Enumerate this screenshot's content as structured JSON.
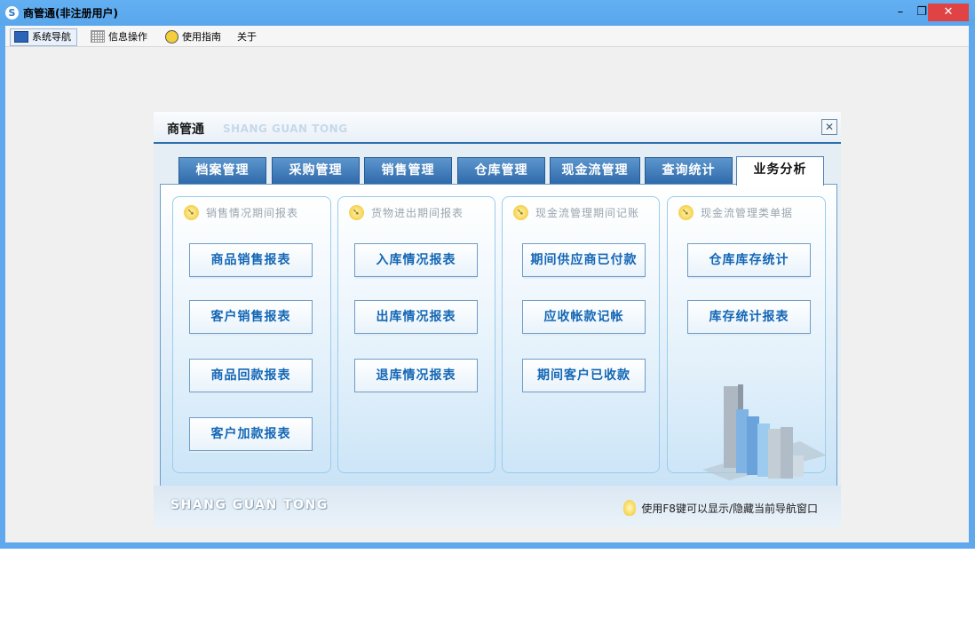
{
  "window": {
    "title": "商管通(非注册用户)",
    "controls": {
      "minimize": "–",
      "maximize": "❐",
      "close": "✕"
    }
  },
  "menu": {
    "items": [
      {
        "label": "系统导航",
        "icon": "monitor-icon"
      },
      {
        "label": "信息操作",
        "icon": "grid-icon"
      },
      {
        "label": "使用指南",
        "icon": "help-icon"
      },
      {
        "label": "关于"
      }
    ]
  },
  "nav": {
    "title": "商管通",
    "subtitle": "SHANG GUAN TONG",
    "close": "✕",
    "tabs": [
      "档案管理",
      "采购管理",
      "销售管理",
      "仓库管理",
      "现金流管理",
      "查询统计",
      "业务分析"
    ],
    "active_tab": "业务分析",
    "groups": [
      {
        "title": "销售情况期间报表",
        "buttons": [
          "商品销售报表",
          "客户销售报表",
          "商品回款报表",
          "客户加款报表"
        ]
      },
      {
        "title": "货物进出期间报表",
        "buttons": [
          "入库情况报表",
          "出库情况报表",
          "退库情况报表"
        ]
      },
      {
        "title": "现金流管理期间记账",
        "buttons": [
          "期间供应商已付款",
          "应收帐款记帐",
          "期间客户已收款"
        ]
      },
      {
        "title": "现金流管理类单据",
        "buttons": [
          "仓库库存统计",
          "库存统计报表"
        ]
      }
    ],
    "footer": {
      "brand": "SHANG GUAN TONG",
      "hint": "使用F8键可以显示/隐藏当前导航窗口"
    }
  },
  "colors": {
    "titlebar": "#5fa8ee",
    "close_button": "#e04343",
    "tab": "#2f6aab",
    "button_text": "#1366b5"
  }
}
